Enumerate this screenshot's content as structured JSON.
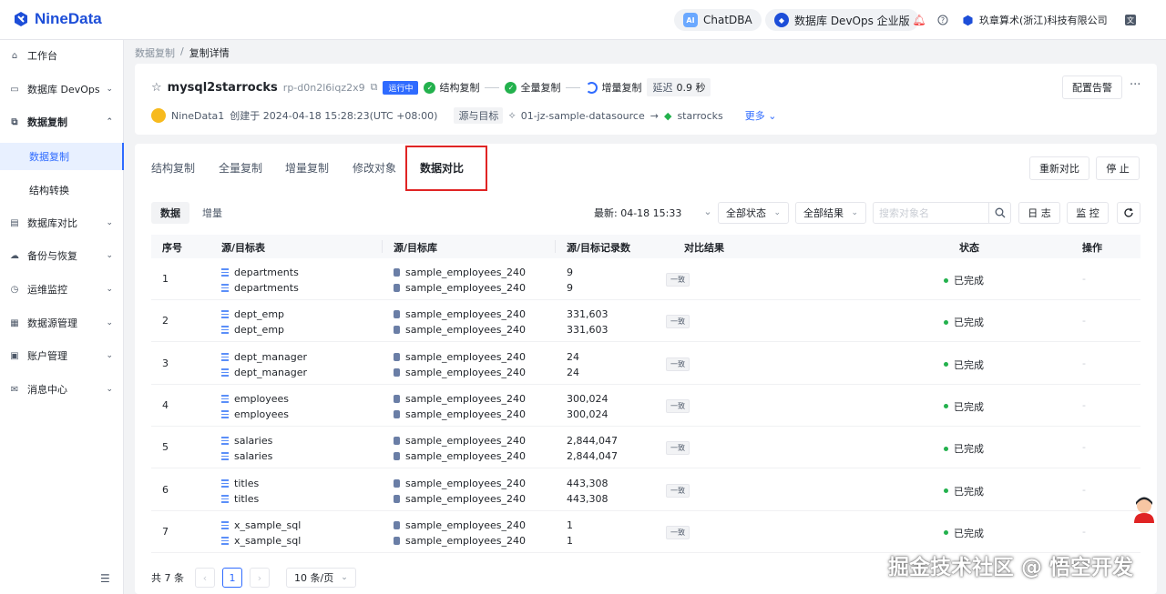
{
  "brand": {
    "name": "NineData"
  },
  "topbar": {
    "chatdba": "ChatDBA",
    "devops": "数据库 DevOps 企业版",
    "company": "玖章算术(浙江)科技有限公司"
  },
  "sidebar": {
    "items": [
      {
        "label": "工作台"
      },
      {
        "label": "数据库 DevOps"
      },
      {
        "label": "数据复制"
      },
      {
        "label": "数据复制"
      },
      {
        "label": "结构转换"
      },
      {
        "label": "数据库对比"
      },
      {
        "label": "备份与恢复"
      },
      {
        "label": "运维监控"
      },
      {
        "label": "数据源管理"
      },
      {
        "label": "账户管理"
      },
      {
        "label": "消息中心"
      }
    ]
  },
  "breadcrumb": {
    "parent": "数据复制",
    "sep": "/",
    "current": "复制详情"
  },
  "task": {
    "name": "mysql2starrocks",
    "id": "rp-d0n2l6iqz2x9",
    "status": "运行中",
    "steps": [
      "结构复制",
      "全量复制",
      "增量复制"
    ],
    "delay_label": "延迟",
    "delay_value": "0.9 秒",
    "creator": "NineData1",
    "created": "创建于 2024-04-18 15:28:23(UTC +08:00)",
    "route_label": "源与目标",
    "source": "01-jz-sample-datasource",
    "target": "starrocks",
    "more": "更多",
    "alert_button": "配置告警",
    "more_dots": "···"
  },
  "tabs": [
    "结构复制",
    "全量复制",
    "增量复制",
    "修改对象",
    "数据对比"
  ],
  "actions": {
    "recompare": "重新对比",
    "stop": "停 止"
  },
  "segments": [
    "数据",
    "增量"
  ],
  "filters": {
    "latest_label": "最新:",
    "latest_value": "04-18 15:33",
    "status_select": "全部状态",
    "result_select": "全部结果",
    "search_placeholder": "搜索对象名",
    "log": "日 志",
    "monitor": "监 控"
  },
  "table": {
    "headers": [
      "序号",
      "源/目标表",
      "源/目标库",
      "源/目标记录数",
      "对比结果",
      "状态",
      "操作"
    ],
    "rows": [
      {
        "no": "1",
        "src_table": "departments",
        "dst_table": "departments",
        "src_db": "sample_employees_240",
        "dst_db": "sample_employees_240",
        "src_count": "9",
        "dst_count": "9",
        "result": "一致",
        "status": "已完成",
        "op": "-"
      },
      {
        "no": "2",
        "src_table": "dept_emp",
        "dst_table": "dept_emp",
        "src_db": "sample_employees_240",
        "dst_db": "sample_employees_240",
        "src_count": "331,603",
        "dst_count": "331,603",
        "result": "一致",
        "status": "已完成",
        "op": "-"
      },
      {
        "no": "3",
        "src_table": "dept_manager",
        "dst_table": "dept_manager",
        "src_db": "sample_employees_240",
        "dst_db": "sample_employees_240",
        "src_count": "24",
        "dst_count": "24",
        "result": "一致",
        "status": "已完成",
        "op": "-"
      },
      {
        "no": "4",
        "src_table": "employees",
        "dst_table": "employees",
        "src_db": "sample_employees_240",
        "dst_db": "sample_employees_240",
        "src_count": "300,024",
        "dst_count": "300,024",
        "result": "一致",
        "status": "已完成",
        "op": "-"
      },
      {
        "no": "5",
        "src_table": "salaries",
        "dst_table": "salaries",
        "src_db": "sample_employees_240",
        "dst_db": "sample_employees_240",
        "src_count": "2,844,047",
        "dst_count": "2,844,047",
        "result": "一致",
        "status": "已完成",
        "op": "-"
      },
      {
        "no": "6",
        "src_table": "titles",
        "dst_table": "titles",
        "src_db": "sample_employees_240",
        "dst_db": "sample_employees_240",
        "src_count": "443,308",
        "dst_count": "443,308",
        "result": "一致",
        "status": "已完成",
        "op": "-"
      },
      {
        "no": "7",
        "src_table": "x_sample_sql",
        "dst_table": "x_sample_sql",
        "src_db": "sample_employees_240",
        "dst_db": "sample_employees_240",
        "src_count": "1",
        "dst_count": "1",
        "result": "一致",
        "status": "已完成",
        "op": "-"
      }
    ]
  },
  "pager": {
    "total": "共 7 条",
    "page": "1",
    "size": "10 条/页"
  },
  "watermark": "掘金技术社区 @ 悟空开发"
}
